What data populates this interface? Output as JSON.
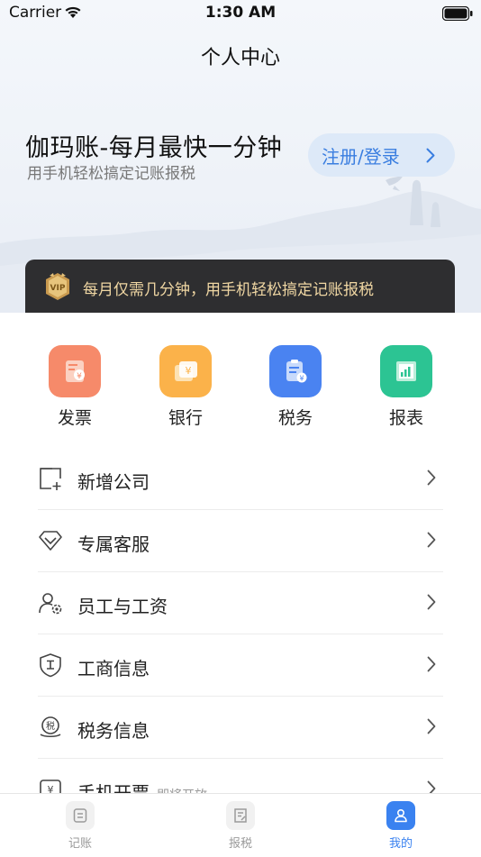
{
  "status_bar": {
    "carrier": "Carrier",
    "time": "1:30 AM"
  },
  "header": {
    "title": "个人中心"
  },
  "hero": {
    "title": "伽玛账-每月最快一分钟",
    "subtitle": "用手机轻松搞定记账报税",
    "login_label": "注册/登录"
  },
  "vip": {
    "badge_icon": "vip-badge-icon",
    "text": "每月仅需几分钟，用手机轻松搞定记账报税"
  },
  "shortcuts": [
    {
      "label": "发票",
      "icon": "invoice-icon",
      "color": "#f68a6a"
    },
    {
      "label": "银行",
      "icon": "bank-icon",
      "color": "#fbb24a"
    },
    {
      "label": "税务",
      "icon": "tax-icon",
      "color": "#4a83f1"
    },
    {
      "label": "报表",
      "icon": "report-icon",
      "color": "#2cc493"
    }
  ],
  "menu": [
    {
      "label": "新增公司",
      "icon": "add-company-icon"
    },
    {
      "label": "专属客服",
      "icon": "diamond-icon"
    },
    {
      "label": "员工与工资",
      "icon": "staff-gear-icon"
    },
    {
      "label": "工商信息",
      "icon": "shield-icon"
    },
    {
      "label": "税务信息",
      "icon": "tax-seal-icon"
    },
    {
      "label": "手机开票",
      "icon": "invoice-yen-icon",
      "tag": "即将开放"
    }
  ],
  "tabbar": [
    {
      "label": "记账",
      "icon": "ledger-icon",
      "active": false
    },
    {
      "label": "报税",
      "icon": "tax-report-icon",
      "active": false
    },
    {
      "label": "我的",
      "icon": "user-icon",
      "active": true
    }
  ],
  "colors": {
    "accent": "#3a82f0",
    "vip_gold": "#f0d7a3",
    "vip_bg": "#2e2e30"
  }
}
